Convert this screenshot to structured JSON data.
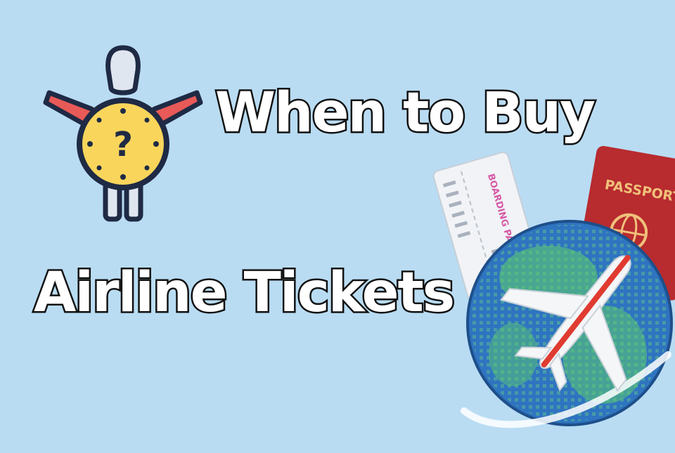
{
  "headline": {
    "line_1": "When to Buy",
    "line_2": "Airline Tickets"
  },
  "illustration": {
    "boarding_pass_label": "BOARDING PASS",
    "passport_label": "PASSPORT",
    "clock_symbol": "?"
  },
  "colors": {
    "background": "#b9dcf3",
    "clock_face": "#f9d55b",
    "outline": "#1f2a44",
    "arms": "#e85a57",
    "passport": "#b82b2f",
    "globe_ocean": "#2f74c0",
    "globe_land": "#5fd06a",
    "plane_accent": "#e03b31"
  },
  "icons": [
    "person-clock-icon",
    "boarding-pass-icon",
    "passport-icon",
    "globe-icon",
    "airplane-icon"
  ]
}
